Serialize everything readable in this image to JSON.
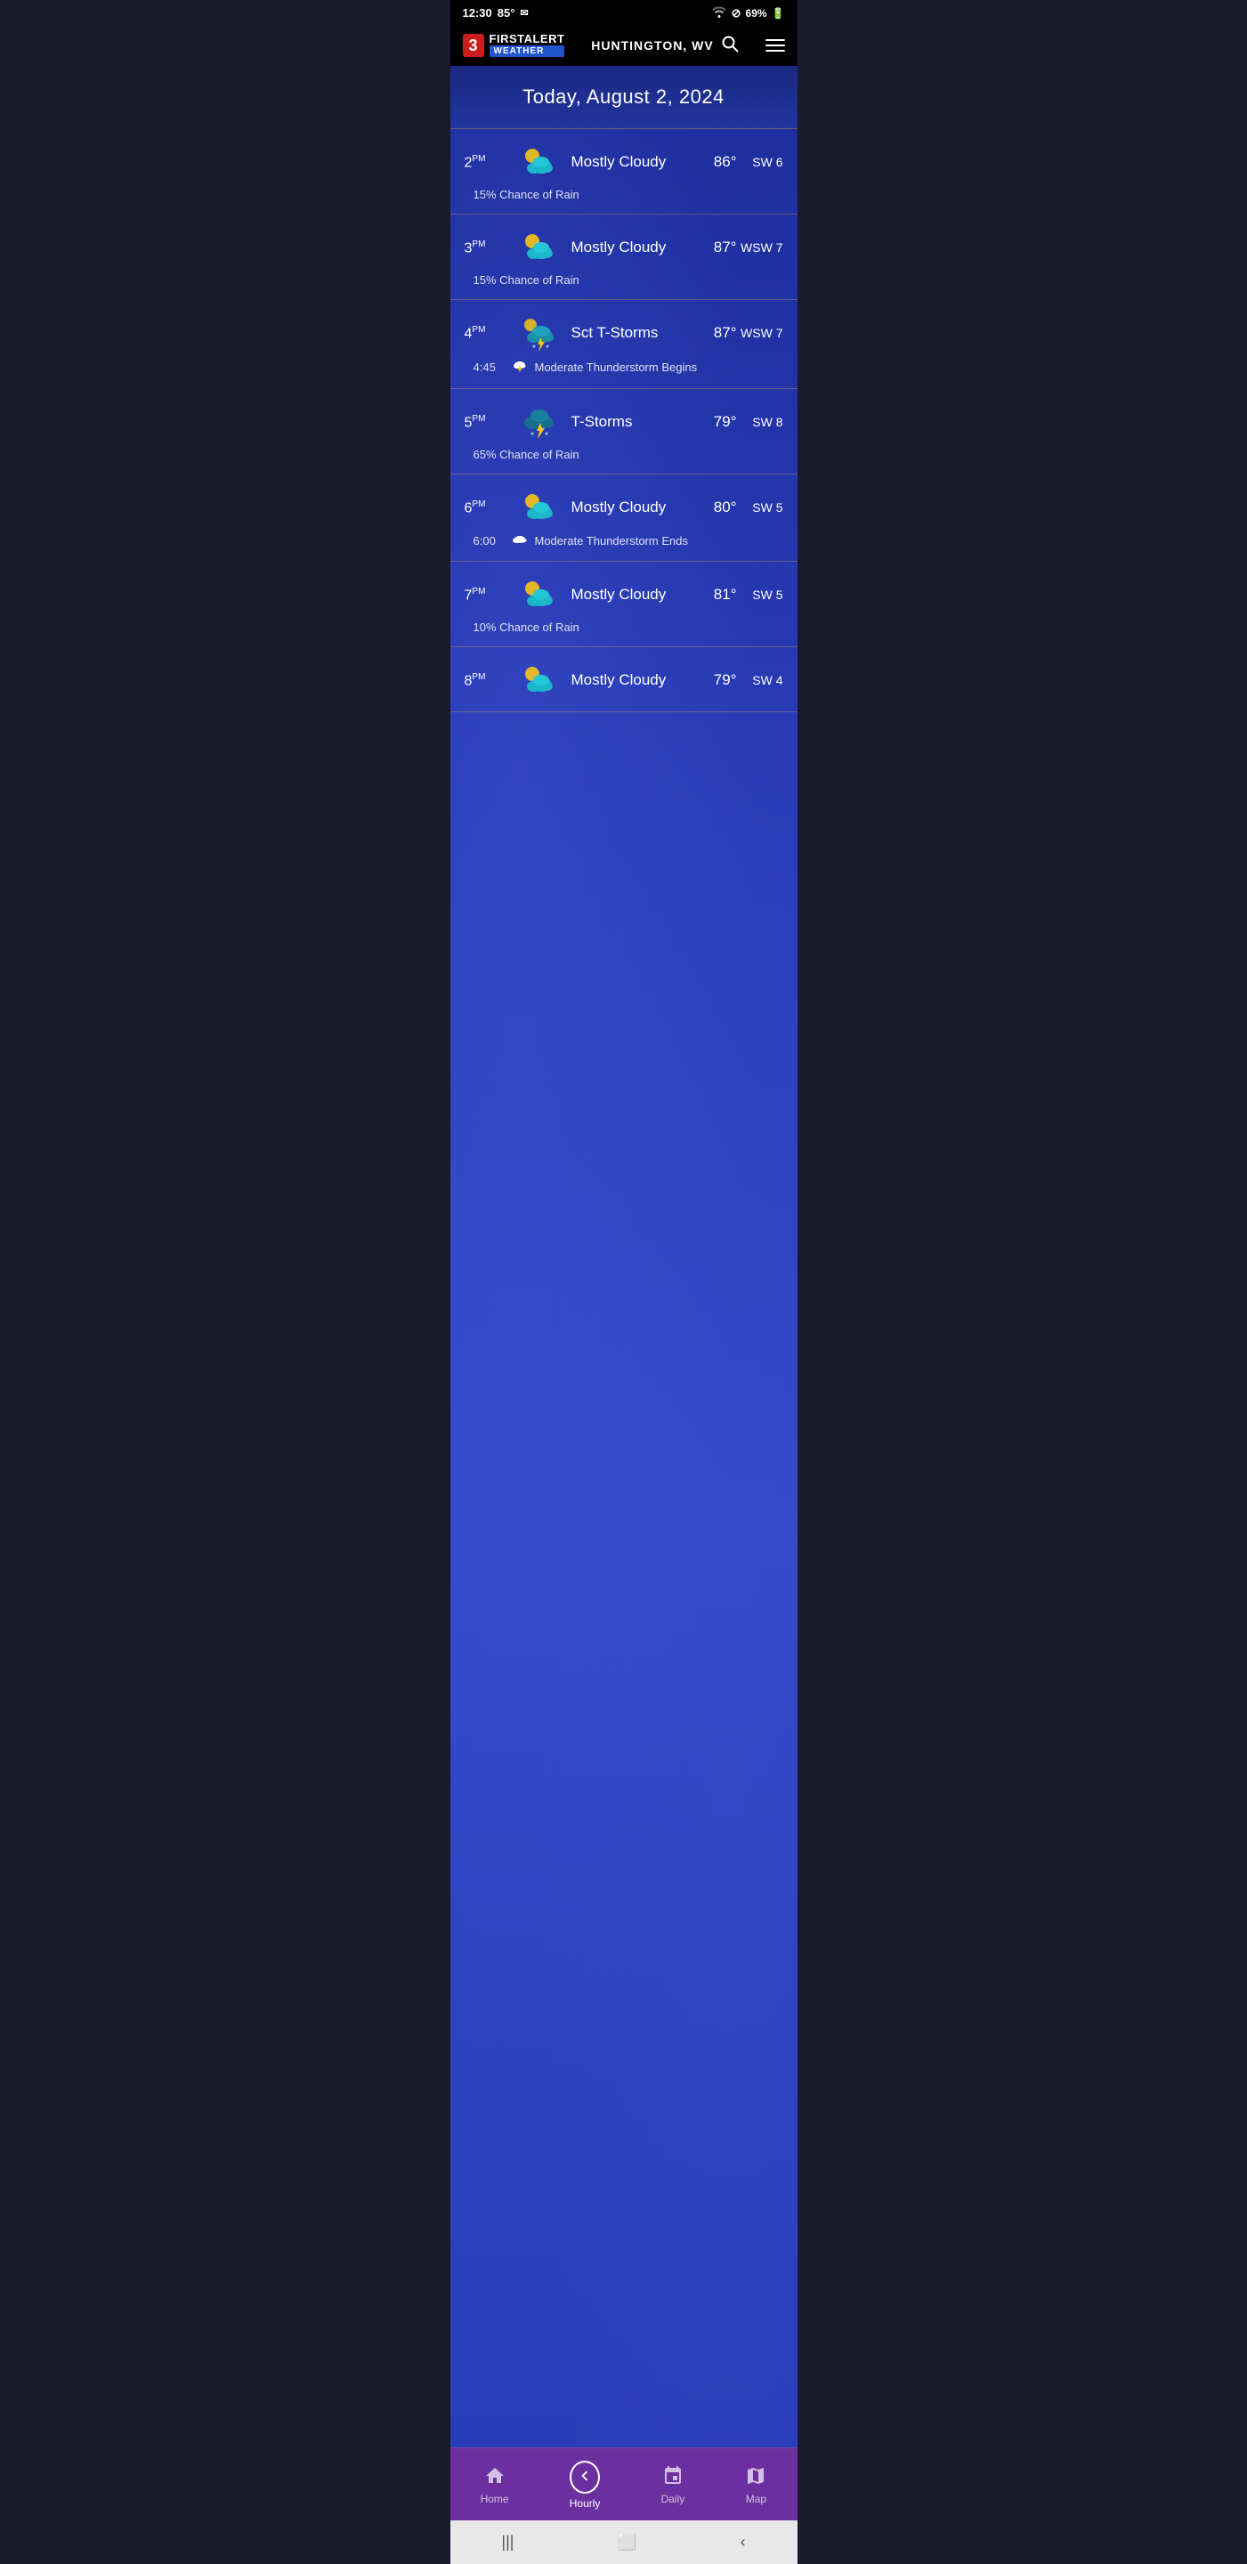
{
  "statusBar": {
    "time": "12:30",
    "temp": "85°",
    "batteryPercent": "69%"
  },
  "header": {
    "logoNumber": "3",
    "logoFirstAlert": "FIRSTALERT",
    "logoWeather": "WEATHER",
    "location": "HUNTINGTON, WV",
    "searchLabel": "search",
    "menuLabel": "menu"
  },
  "dateHeader": {
    "text": "Today, August 2, 2024"
  },
  "hourlyRows": [
    {
      "time": "2",
      "ampm": "PM",
      "icon": "mostly-cloudy-day",
      "description": "Mostly Cloudy",
      "temp": "86°",
      "wind": "SW 6",
      "detail": "15% Chance of Rain",
      "detailTime": null,
      "detailIcon": null
    },
    {
      "time": "3",
      "ampm": "PM",
      "icon": "mostly-cloudy-day",
      "description": "Mostly Cloudy",
      "temp": "87°",
      "wind": "WSW 7",
      "detail": "15% Chance of Rain",
      "detailTime": null,
      "detailIcon": null
    },
    {
      "time": "4",
      "ampm": "PM",
      "icon": "sct-tstorm",
      "description": "Sct T-Storms",
      "temp": "87°",
      "wind": "WSW 7",
      "detail": "Moderate Thunderstorm Begins",
      "detailTime": "4:45",
      "detailIcon": "cloud-thunder"
    },
    {
      "time": "5",
      "ampm": "PM",
      "icon": "tstorm",
      "description": "T-Storms",
      "temp": "79°",
      "wind": "SW 8",
      "detail": "65% Chance of Rain",
      "detailTime": null,
      "detailIcon": null
    },
    {
      "time": "6",
      "ampm": "PM",
      "icon": "mostly-cloudy-day",
      "description": "Mostly Cloudy",
      "temp": "80°",
      "wind": "SW 5",
      "detail": "Moderate Thunderstorm Ends",
      "detailTime": "6:00",
      "detailIcon": "cloud"
    },
    {
      "time": "7",
      "ampm": "PM",
      "icon": "mostly-cloudy-day",
      "description": "Mostly Cloudy",
      "temp": "81°",
      "wind": "SW 5",
      "detail": "10% Chance of Rain",
      "detailTime": null,
      "detailIcon": null
    },
    {
      "time": "8",
      "ampm": "PM",
      "icon": "mostly-cloudy-day",
      "description": "Mostly Cloudy",
      "temp": "79°",
      "wind": "SW 4",
      "detail": null,
      "detailTime": null,
      "detailIcon": null
    }
  ],
  "bottomNav": {
    "items": [
      {
        "id": "home",
        "label": "Home",
        "icon": "🏠",
        "active": false
      },
      {
        "id": "hourly",
        "label": "Hourly",
        "icon": "◀",
        "active": true
      },
      {
        "id": "daily",
        "label": "Daily",
        "icon": "📅",
        "active": false
      },
      {
        "id": "map",
        "label": "Map",
        "icon": "🗺",
        "active": false
      }
    ]
  }
}
